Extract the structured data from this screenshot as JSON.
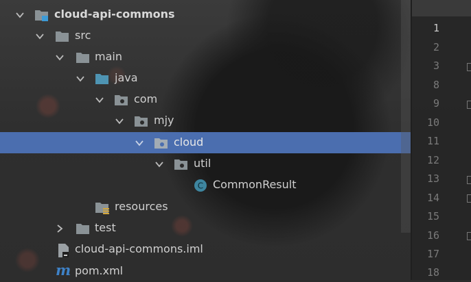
{
  "project_tree": {
    "items": [
      {
        "label": "cloud-api-commons",
        "type": "module",
        "expanded": true
      },
      {
        "label": "src",
        "type": "folder",
        "expanded": true
      },
      {
        "label": "main",
        "type": "folder",
        "expanded": true
      },
      {
        "label": "java",
        "type": "source-folder",
        "expanded": true
      },
      {
        "label": "com",
        "type": "package",
        "expanded": true
      },
      {
        "label": "mjy",
        "type": "package",
        "expanded": true
      },
      {
        "label": "cloud",
        "type": "package",
        "expanded": true,
        "selected": true
      },
      {
        "label": "util",
        "type": "package",
        "expanded": true
      },
      {
        "label": "CommonResult",
        "type": "class",
        "icon_letter": "C"
      },
      {
        "label": "resources",
        "type": "resources-folder"
      },
      {
        "label": "test",
        "type": "folder",
        "expanded": false
      },
      {
        "label": "cloud-api-commons.iml",
        "type": "iml-file"
      },
      {
        "label": "pom.xml",
        "type": "maven-file",
        "icon_letter": "m"
      }
    ]
  },
  "gutter": {
    "line_numbers": [
      "1",
      "2",
      "3",
      "8",
      "9",
      "10",
      "11",
      "12",
      "13",
      "14",
      "15",
      "16",
      "17",
      "18"
    ],
    "current_line": "1"
  },
  "colors": {
    "selection": "#4b6eaf",
    "folder": "#8a9296",
    "source_folder": "#4e94b3",
    "class_icon": "#3e86a0",
    "maven": "#3e82c8"
  }
}
